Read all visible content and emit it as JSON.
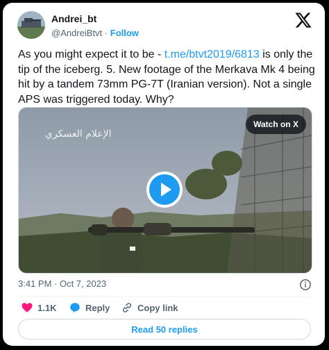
{
  "user": {
    "name": "Andrei_bt",
    "handle": "@AndreiBtvt",
    "separator": "·",
    "follow_label": "Follow"
  },
  "tweet": {
    "text_before": "As you might expect it to be - ",
    "link_text": "t.me/btvt2019/6813",
    "text_after": " is only the tip of the iceberg. 5. New footage of the Merkava Mk 4 being hit by a tandem 73mm PG-7T (Iranian version). Not a single APS was triggered today. Why?"
  },
  "media": {
    "watch_label": "Watch on X",
    "watermark_text": "الإعلام العسكري"
  },
  "timestamp": "3:41 PM · Oct 7, 2023",
  "actions": {
    "likes_count": "1.1K",
    "reply_label": "Reply",
    "copy_link_label": "Copy link"
  },
  "read_replies_label": "Read 50 replies",
  "colors": {
    "accent": "#1d9bf0",
    "like": "#f91880",
    "text": "#0f1419",
    "muted": "#536471"
  },
  "icons": [
    "x-logo-icon",
    "play-icon",
    "info-icon",
    "heart-icon",
    "reply-icon",
    "link-icon"
  ]
}
